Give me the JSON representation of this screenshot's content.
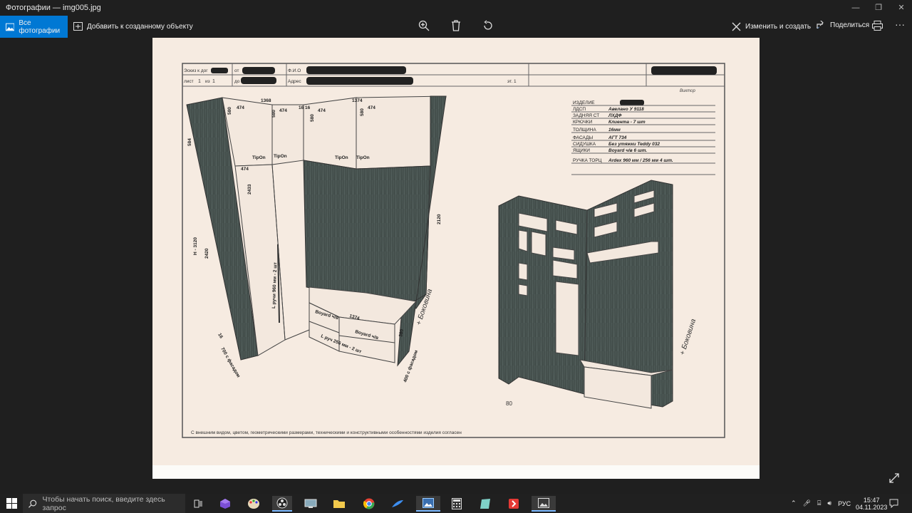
{
  "window": {
    "title": "Фотографии — img005.jpg",
    "minimize": "—",
    "restore": "❐",
    "close": "✕"
  },
  "toolbar": {
    "all_photos": "Все фотографии",
    "add_to_object": "Добавить к созданному объекту",
    "edit_create": "Изменить и создать",
    "share": "Поделиться",
    "icons": [
      "photos-icon",
      "add-icon",
      "zoom-icon",
      "delete-icon",
      "rotate-icon",
      "edit-icon",
      "share-icon",
      "print-icon",
      "more-icon"
    ]
  },
  "drawing": {
    "header": {
      "escape": "Эскиз к дог",
      "from": "от",
      "fio": "Ф.И.О",
      "sheet": "лист",
      "sheet_num": "1",
      "of": "из",
      "sheet_total": "1",
      "do": "до",
      "address": "Адрес",
      "tel": "эт. 1",
      "author": "Виктор"
    },
    "specs": [
      {
        "label": "ИЗДЕЛИЕ",
        "value": ""
      },
      {
        "label": "ЛДСП",
        "value": "Авелано У 9118"
      },
      {
        "label": "ЗАДНЯЯ СТ",
        "value": "ЛХДФ"
      },
      {
        "label": "КРЮЧКИ",
        "value": "Клиента - 7 шт"
      },
      {
        "label": "ТОЛЩИНА",
        "value": "16мм"
      },
      {
        "label": "ФАСАДЫ",
        "value": "АГТ 734"
      },
      {
        "label": "СИДУШКА",
        "value": "Без утяжки   Teddy 032"
      },
      {
        "label": "ЯЩИКИ",
        "value": "Boyard ч/в          6 шт."
      },
      {
        "label": "РУЧКА ТОРЦ",
        "value": "Ardex 960 мм / 256 мм     4 шт."
      }
    ],
    "dims": {
      "w1": "1368",
      "w2": "1374",
      "d1": "474",
      "d2": "474",
      "d3": "474",
      "d4": "474",
      "d5": "474",
      "d6": "474",
      "h580a": "580",
      "h580b": "580",
      "h580c": "580",
      "h580d": "580",
      "h584": "584",
      "h2433": "2433",
      "h3120": "Н - 3120",
      "h2420": "2420",
      "h2120": "2120",
      "h1616": "16 16",
      "tipon1": "TipOn",
      "tipon2": "TipOn",
      "tipon3": "TipOn",
      "tipon4": "TipOn",
      "handle": "L ручи 960 мм - 2 шт",
      "boyard1": "Boyard ч/в",
      "boyard2": "Boyard ч/в",
      "bench_w": "1374",
      "bench_h": "380",
      "handle2": "L руч 256 мм - 2 шт",
      "left_note": "700 с фасадом",
      "right_note": "400 с фасадом",
      "s16": "16",
      "bokovina1": "+ Боковина",
      "bokovina2": "+ Боковина",
      "s80": "80"
    },
    "footer": "С внешним видом, цветом, геометрическими размерами, техническими и конструктивными особенностями изделия согласен"
  },
  "taskbar": {
    "search_placeholder": "Чтобы начать поиск, введите здесь запрос",
    "lang": "РУС",
    "time": "15:47",
    "date": "04.11.2023",
    "apps": [
      "task-view-icon",
      "cube-app-icon",
      "paint-icon",
      "obs-icon",
      "remote-icon",
      "folder-icon",
      "chrome-icon",
      "feather-icon",
      "photos-app-icon",
      "calculator-icon",
      "notepad-icon",
      "anydesk-icon",
      "image-viewer-icon"
    ]
  }
}
